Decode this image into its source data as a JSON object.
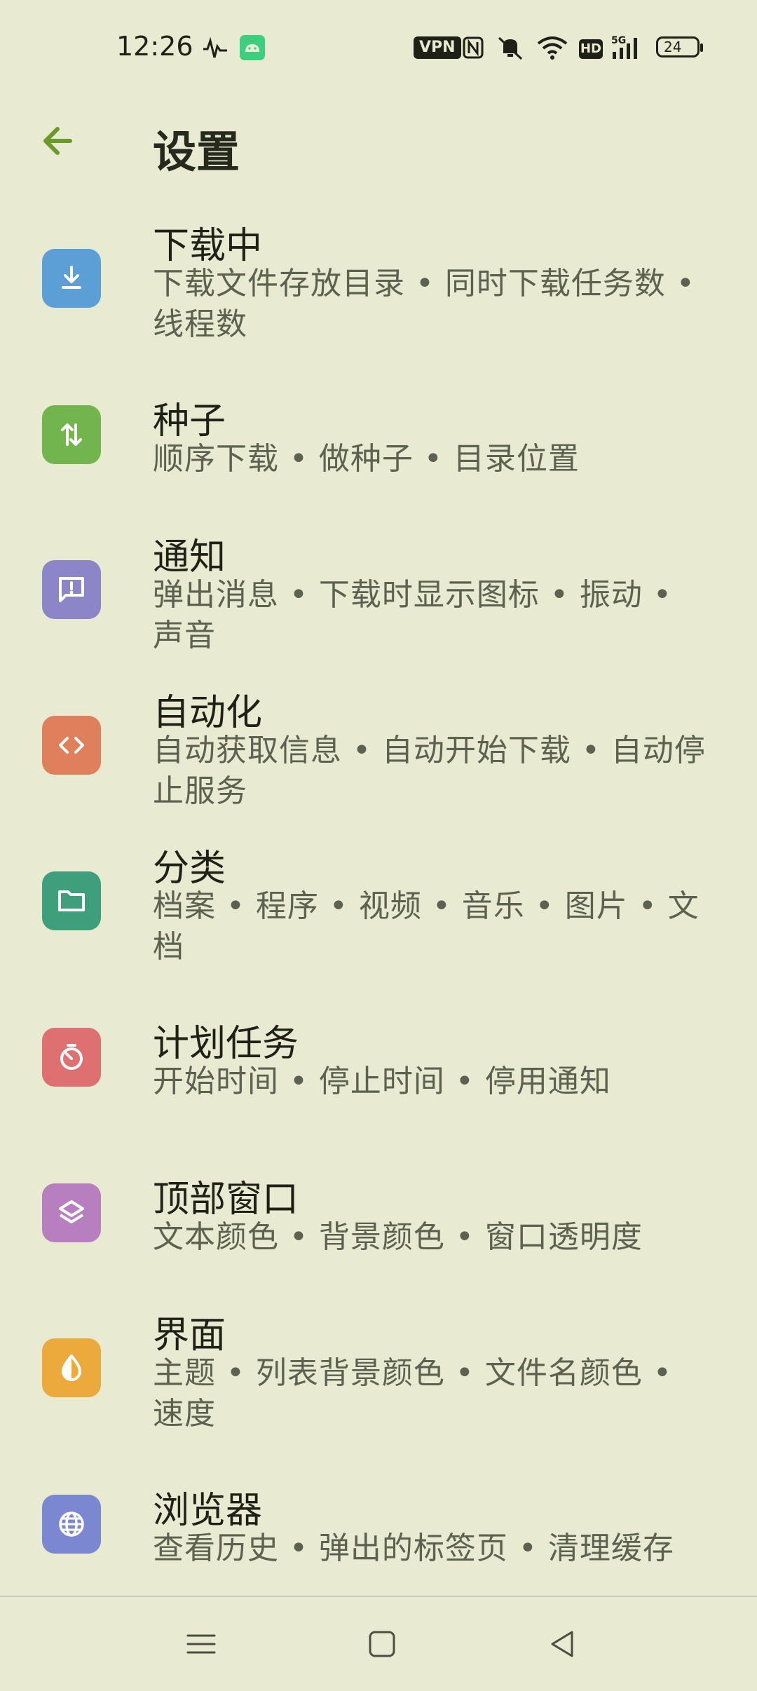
{
  "status_bar": {
    "time": "12:26",
    "vpn": "VPN",
    "hd": "HD",
    "network": "5G",
    "battery": "24",
    "icons": [
      "activity-icon",
      "android-app-icon",
      "nfc-icon",
      "mute-icon",
      "wifi-icon",
      "signal-icon",
      "battery-icon"
    ]
  },
  "header": {
    "title": "设置",
    "back_icon": "arrow-left-icon"
  },
  "settings": [
    {
      "title": "下载中",
      "summary": "下载文件存放目录 • 同时下载任务数 • 线程数",
      "icon": "download-icon",
      "color": "#5b9fd6"
    },
    {
      "title": "种子",
      "summary": "顺序下载 • 做种子 • 目录位置",
      "icon": "swap-vertical-icon",
      "color": "#73b54d"
    },
    {
      "title": "通知",
      "summary": "弹出消息 • 下载时显示图标 • 振动 • 声音",
      "icon": "message-alert-icon",
      "color": "#8c86c8"
    },
    {
      "title": "自动化",
      "summary": "自动获取信息 • 自动开始下载 • 自动停止服务",
      "icon": "code-icon",
      "color": "#e07f5b"
    },
    {
      "title": "分类",
      "summary": "档案 • 程序 • 视频 • 音乐 • 图片 • 文档",
      "icon": "folder-icon",
      "color": "#3f9f7c"
    },
    {
      "title": "计划任务",
      "summary": "开始时间 • 停止时间 • 停用通知",
      "icon": "timer-icon",
      "color": "#df7072"
    },
    {
      "title": "顶部窗口",
      "summary": "文本颜色 • 背景颜色 • 窗口透明度",
      "icon": "layers-icon",
      "color": "#b77fc0"
    },
    {
      "title": "界面",
      "summary": "主题 • 列表背景颜色 • 文件名颜色 • 速度",
      "icon": "contrast-icon",
      "color": "#ecaa3c"
    },
    {
      "title": "浏览器",
      "summary": "查看历史 • 弹出的标签页 • 清理缓存",
      "icon": "globe-icon",
      "color": "#7c87d2"
    }
  ],
  "nav_bar": {
    "buttons": [
      "menu-icon",
      "home-icon",
      "back-icon"
    ]
  }
}
